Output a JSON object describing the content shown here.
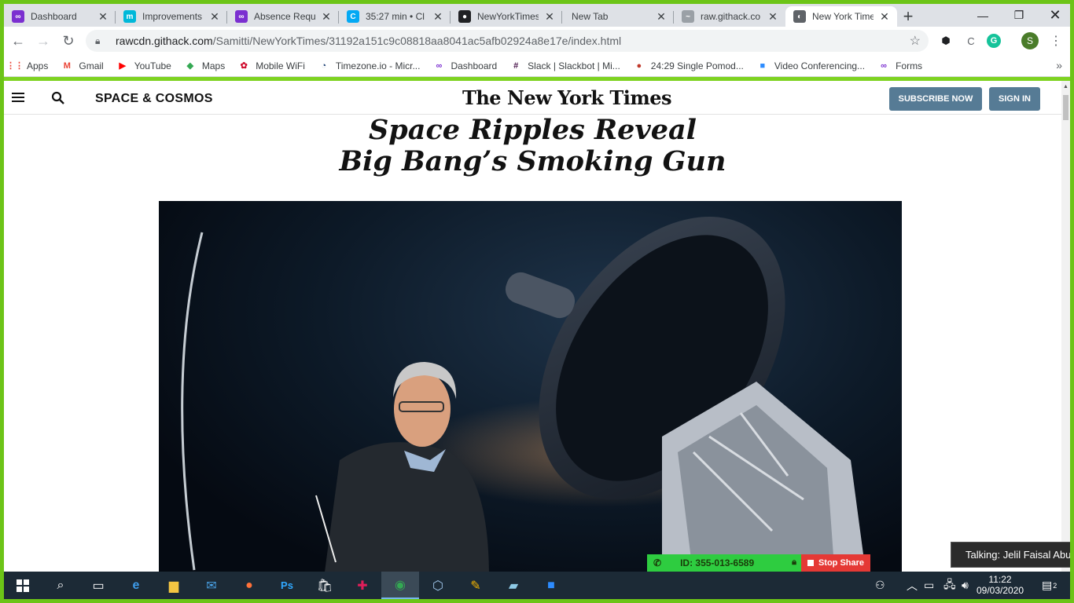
{
  "tabs": [
    {
      "title": "Dashboard",
      "icon": "dashboard-icon",
      "color": "#7b2fd0",
      "glyph": "∞"
    },
    {
      "title": "Improvements",
      "icon": "miro-icon",
      "color": "#00b8d9",
      "glyph": "m"
    },
    {
      "title": "Absence Requ",
      "icon": "dashboard-icon",
      "color": "#7b2fd0",
      "glyph": "∞"
    },
    {
      "title": "35:27 min • Cl",
      "icon": "clockify-icon",
      "color": "#03a9f4",
      "glyph": "C"
    },
    {
      "title": "NewYorkTimes",
      "icon": "github-icon",
      "color": "#202124",
      "glyph": "●"
    },
    {
      "title": "New Tab",
      "icon": "",
      "color": "",
      "glyph": ""
    },
    {
      "title": "raw.githack.co",
      "icon": "githack-icon",
      "color": "#9aa0a6",
      "glyph": "~"
    },
    {
      "title": "New York Time",
      "icon": "globe-icon",
      "color": "#5f6368",
      "glyph": "◐"
    }
  ],
  "toolbar": {
    "url_host": "rawcdn.githack.com",
    "url_path": "/Samitti/NewYorkTimes/31192a151c9c08818aa8041ac5afb02924a8e17e/index.html",
    "profile_initial": "S"
  },
  "bookmarks": [
    {
      "label": "Apps",
      "icon": "apps-grid-icon",
      "color": "#ea4335",
      "glyph": "⋮⋮"
    },
    {
      "label": "Gmail",
      "icon": "gmail-icon",
      "color": "#ea4335",
      "glyph": "M"
    },
    {
      "label": "YouTube",
      "icon": "youtube-icon",
      "color": "#ff0000",
      "glyph": "▶"
    },
    {
      "label": "Maps",
      "icon": "maps-icon",
      "color": "#34a853",
      "glyph": "◆"
    },
    {
      "label": "Mobile WiFi",
      "icon": "huawei-icon",
      "color": "#cf0a2c",
      "glyph": "✿"
    },
    {
      "label": "Timezone.io - Micr...",
      "icon": "timezone-icon",
      "color": "#1a3e72",
      "glyph": "◔"
    },
    {
      "label": "Dashboard",
      "icon": "dashboard-icon",
      "color": "#7b2fd0",
      "glyph": "∞"
    },
    {
      "label": "Slack | Slackbot | Mi...",
      "icon": "slack-icon",
      "color": "#4a154b",
      "glyph": "#"
    },
    {
      "label": "24:29 Single Pomod...",
      "icon": "tomato-icon",
      "color": "#c0392b",
      "glyph": "●"
    },
    {
      "label": "Video Conferencing...",
      "icon": "zoom-icon",
      "color": "#2d8cff",
      "glyph": "■"
    },
    {
      "label": "Forms",
      "icon": "dashboard-icon",
      "color": "#7b2fd0",
      "glyph": "∞"
    }
  ],
  "masthead": {
    "section": "SPACE & COSMOS",
    "logo": "The New York Times",
    "subscribe": "SUBSCRIBE NOW",
    "signin": "SIGN IN"
  },
  "article": {
    "headline_line1": "Space Ripples Reveal",
    "headline_line2": "Big Bang’s Smoking Gun"
  },
  "zoom": {
    "meeting_id": "ID: 355-013-6589",
    "stop_share": "Stop Share",
    "talking": "Talking: Jelil Faisal Abud"
  },
  "clock": {
    "time": "11:22",
    "date": "09/03/2020"
  },
  "notifications": "2"
}
